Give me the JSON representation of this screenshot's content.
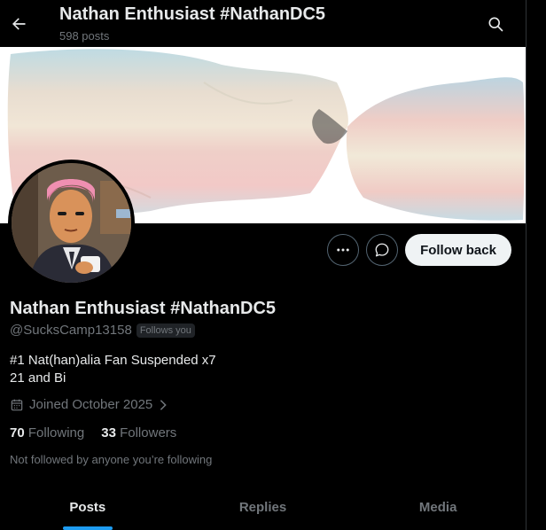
{
  "header": {
    "title": "Nathan Enthusiast #NathanDC5",
    "post_count": "598 posts"
  },
  "profile": {
    "display_name": "Nathan Enthusiast #NathanDC5",
    "handle": "@SucksCamp13158",
    "follows_you": "Follows you",
    "bio_line1": "#1 Nat(han)alia Fan Suspended x7",
    "bio_line2": "21 and Bi",
    "joined": "Joined October 2025",
    "following_count": "70",
    "following_label": "Following",
    "followers_count": "33",
    "followers_label": "Followers",
    "not_followed": "Not followed by anyone you’re following"
  },
  "actions": {
    "follow_back": "Follow back"
  },
  "tabs": [
    {
      "label": "Posts",
      "active": true
    },
    {
      "label": "Replies",
      "active": false
    },
    {
      "label": "Media",
      "active": false
    }
  ],
  "colors": {
    "background": "#000000",
    "text": "#e7e9ea",
    "muted": "#71767b",
    "accent": "#1d9bf0",
    "button_bg": "#eff3f4"
  },
  "icons": {
    "back": "arrow-left",
    "search": "magnifying-glass",
    "more": "ellipsis",
    "message": "chat-bubble",
    "calendar": "calendar",
    "chevron": "chevron-right"
  }
}
